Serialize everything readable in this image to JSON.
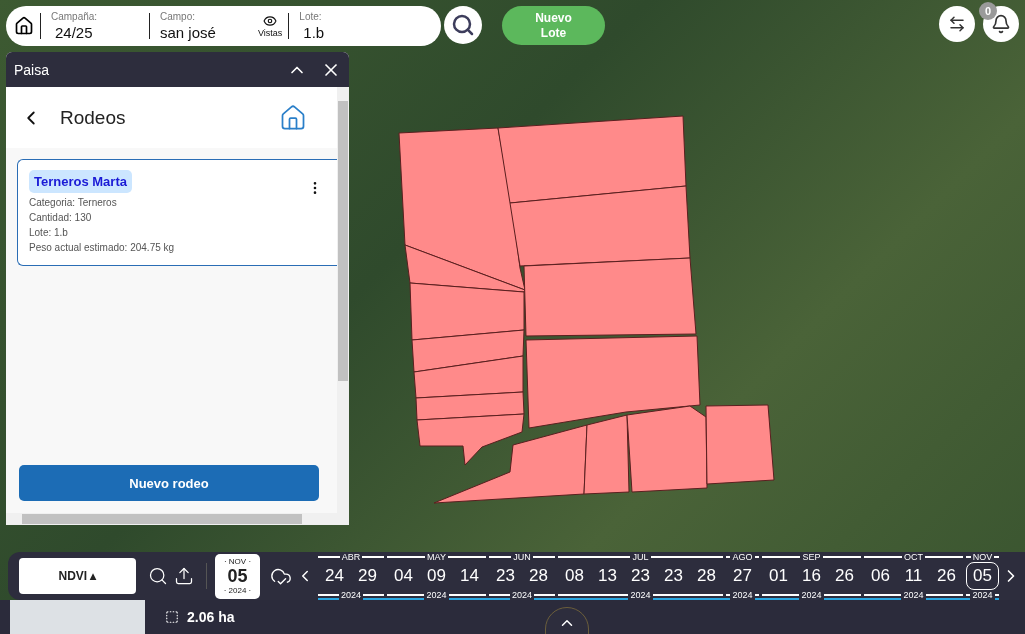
{
  "top_bar": {
    "campaign": {
      "label": "Campaña:",
      "value": "24/25"
    },
    "field": {
      "label": "Campo:",
      "value": "san josé"
    },
    "views": {
      "label": "Vistas"
    },
    "lot": {
      "label": "Lote:",
      "value": "1.b"
    },
    "new_lot_button": [
      "Nuevo",
      "Lote"
    ],
    "notifications": {
      "count": "0"
    }
  },
  "panel": {
    "title": "Paisa",
    "heading": "Rodeos",
    "cards": [
      {
        "name": "Terneros Marta",
        "details": [
          "Categoria: Terneros",
          "Cantidad: 130",
          "Lote: 1.b",
          "Peso actual estimado: 204.75 kg"
        ]
      }
    ],
    "primary_button": "Nuevo rodeo"
  },
  "timeline": {
    "layer": "NDVI ▴",
    "current_date": {
      "month": "· NOV ·",
      "day": "05",
      "year": "· 2024 ·"
    },
    "months": [
      {
        "label": "ABR",
        "year": "2024",
        "days": [
          {
            "label": "24",
            "selected": false
          },
          {
            "label": "29",
            "selected": false
          }
        ]
      },
      {
        "label": "MAY",
        "year": "2024",
        "days": [
          {
            "label": "04",
            "selected": false
          },
          {
            "label": "09",
            "selected": false
          },
          {
            "label": "14",
            "selected": false
          }
        ]
      },
      {
        "label": "JUN",
        "year": "2024",
        "days": [
          {
            "label": "23",
            "selected": false
          },
          {
            "label": "28",
            "selected": false
          }
        ]
      },
      {
        "label": "JUL",
        "year": "2024",
        "days": [
          {
            "label": "08",
            "selected": false
          },
          {
            "label": "13",
            "selected": false
          },
          {
            "label": "23",
            "selected": false
          },
          {
            "label": "23",
            "selected": false
          },
          {
            "label": "28",
            "selected": false
          }
        ]
      },
      {
        "label": "AGO",
        "year": "2024",
        "days": [
          {
            "label": "27",
            "selected": false
          }
        ]
      },
      {
        "label": "SEP",
        "year": "2024",
        "days": [
          {
            "label": "01",
            "selected": false
          },
          {
            "label": "16",
            "selected": false
          },
          {
            "label": "26",
            "selected": false
          }
        ]
      },
      {
        "label": "OCT",
        "year": "2024",
        "days": [
          {
            "label": "06",
            "selected": false
          },
          {
            "label": "11",
            "selected": false
          },
          {
            "label": "26",
            "selected": false
          }
        ]
      },
      {
        "label": "NOV",
        "year": "2024",
        "days": [
          {
            "label": "05",
            "selected": true
          }
        ]
      }
    ]
  },
  "status_bar": {
    "area": "2.06 ha"
  }
}
